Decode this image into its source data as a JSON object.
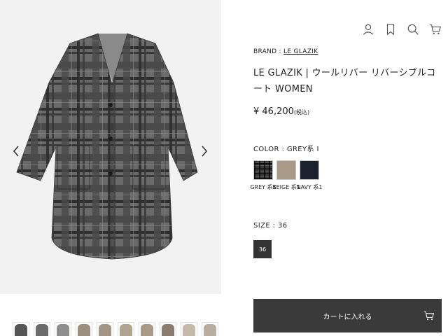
{
  "brand": {
    "prefix": "BRAND : ",
    "name": "LE GLAZIK"
  },
  "product": {
    "title": "LE GLAZIK | ウールリバー リバーシブルコート WOMEN",
    "price": "¥ 46,200",
    "tax_note": "(税込)"
  },
  "color": {
    "label": "COLOR : GREY系 I",
    "options": [
      {
        "name": "GREY 系1",
        "icon": "grey-check-swatch",
        "color": "#3a3a3a"
      },
      {
        "name": "BEIGE 系1",
        "icon": "beige-swatch",
        "color": "#a99a88"
      },
      {
        "name": "NAVY 系1",
        "icon": "navy-swatch",
        "color": "#1c2130"
      }
    ]
  },
  "size": {
    "label": "SIZE : 36",
    "options": [
      "36"
    ]
  },
  "cart": {
    "label": "カートに入れる",
    "icon": "cart-icon"
  },
  "header_icons": [
    "user-icon",
    "bookmark-icon",
    "search-icon",
    "cart-icon"
  ],
  "gallery": {
    "prev_icon": "chevron-left-icon",
    "next_icon": "chevron-right-icon"
  },
  "thumbnails": [
    {
      "name": "thumbnail",
      "color": "#555555"
    },
    {
      "name": "thumbnail",
      "color": "#6b6b6b"
    },
    {
      "name": "thumbnail",
      "color": "#8e8e8e"
    },
    {
      "name": "thumbnail",
      "color": "#9c8f80"
    },
    {
      "name": "thumbnail",
      "color": "#a39684"
    },
    {
      "name": "thumbnail",
      "color": "#b0a390"
    },
    {
      "name": "thumbnail",
      "color": "#a99a88"
    },
    {
      "name": "thumbnail",
      "color": "#8a7c6c"
    },
    {
      "name": "thumbnail",
      "color": "#c5b9a8"
    },
    {
      "name": "thumbnail",
      "color": "#b8ad9f"
    }
  ],
  "colors": {
    "text": "#222222",
    "button_dark": "#3a3a3a",
    "size_selected": "#333333",
    "gallery_bg": "#f2f2f2"
  }
}
